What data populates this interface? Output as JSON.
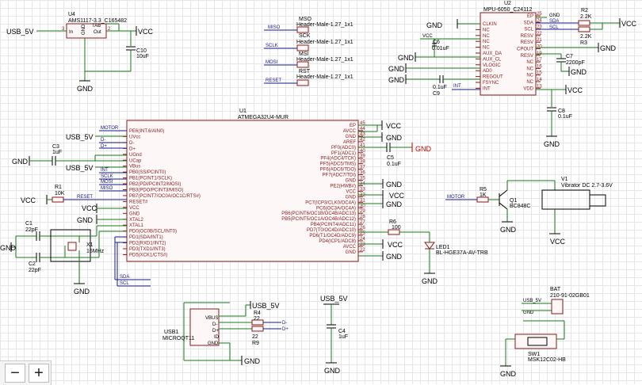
{
  "components": {
    "u4": {
      "ref": "U4",
      "part": "AMS1117-3.3_C165482",
      "pins": [
        "In",
        "GND",
        "Out",
        "TAB"
      ],
      "pin_numbers": [
        "3",
        "1",
        "2",
        "4"
      ]
    },
    "c10": {
      "ref": "C10",
      "value": "10uF"
    },
    "u2": {
      "ref": "U2",
      "part": "MPU-6050_C24112",
      "left_pins": [
        "CLKIN",
        "NC",
        "NC",
        "NC",
        "NC",
        "AUX_DA",
        "AUX_CL",
        "VLOGIC",
        "AD0",
        "REGOUT",
        "FSYNC",
        "INT"
      ],
      "right_pins": [
        "EP",
        "SDA",
        "SCL",
        "RESV",
        "RESV",
        "CPOUT",
        "RESV",
        "NC",
        "NC",
        "NC",
        "NC",
        "VDD"
      ],
      "right_numbers": [
        "25",
        "24",
        "23",
        "22",
        "21",
        "20",
        "19",
        "17",
        "16",
        "15",
        "14",
        "13"
      ]
    },
    "r2": {
      "ref": "R2",
      "value": "2.2K"
    },
    "r3": {
      "ref": "R3",
      "value": "2.2K"
    },
    "c6": {
      "ref": "C6",
      "value": "0.01uF"
    },
    "c7": {
      "ref": "C7",
      "value": "2200pF"
    },
    "c9": {
      "ref": "C9",
      "value": "0.1uF"
    },
    "c8": {
      "ref": "C8",
      "value": "0.1uF"
    },
    "headers": [
      {
        "net": "MISO",
        "ref": "MSO",
        "part": "Header-Male-1.27_1x1"
      },
      {
        "net": "SCLK",
        "ref": "SCK",
        "part": "Header-Male-1.27_1x1"
      },
      {
        "net": "MOSI",
        "ref": "MSI",
        "part": "Header-Male-1.27_1x1"
      },
      {
        "net": "RESET",
        "ref": "RST",
        "part": "Header-Male-1.27_1x1"
      }
    ],
    "u1": {
      "ref": "U1",
      "part": "ATMEGA32U4-MUR",
      "left_pins": [
        "PE6(INT.6/AIN0)",
        "UVcc",
        "D-",
        "D+",
        "UGnd",
        "UCap",
        "VBus",
        "PB0(SS/PCINT0)",
        "PB1(PCINT1/SCLK)",
        "PB2(PDI/PCINT2/MOSI)",
        "PB3(PDO/PCINT3/MISO)",
        "PB7(PCINT7/OC0A/OC1C/RTS#)",
        "RESET#",
        "VCC",
        "GND",
        "XTAL2",
        "XTAL1",
        "PD0(OC0B/SCL/INT0)",
        "PD1(SDA/INT1)",
        "PD2(RXD1/INT2)",
        "PD3(TXD1/INT3)",
        "PD5(XCK1/CTS#)"
      ],
      "right_pins": [
        "EP",
        "AVCC",
        "GND",
        "AREF",
        "PF0(ADC0)",
        "PF1(ADC1)",
        "PF4(ADC4/TCK)",
        "PF5(ADC5/TMS)",
        "PF6(ADC6/TDO)",
        "PF7(ADC7/TDI)",
        "GND",
        "PE2(HWB#)",
        "VCC",
        "GND",
        "PC7(ICP3/CLK0/OC4A)",
        "PC6(OC3A/OC4A)",
        "PB6(PCINT6/OC1B/OC4B/ADC13)",
        "PB5(PCINT5/OC1A/OC4B/ADC12)",
        "PB4(PCINT4/ADC11)",
        "PD7(T0/OC4D/ADC10)",
        "PD6(T1/OC4D/ADC9)",
        "PD4(ICP1/ADC8)",
        "AVCC",
        "GND"
      ],
      "right_numbers": [
        "45",
        "44",
        "43",
        "42",
        "41",
        "40",
        "39",
        "38",
        "37",
        "36",
        "35",
        "34",
        "33",
        "32",
        "31",
        "30",
        "29",
        "28",
        "27",
        "26",
        "25",
        "24",
        "23",
        "22"
      ]
    },
    "c3": {
      "ref": "C3",
      "value": "1uF"
    },
    "c5": {
      "ref": "C5",
      "value": "0.1uF"
    },
    "r1": {
      "ref": "R1",
      "value": "10K"
    },
    "c1": {
      "ref": "C1",
      "value": "22pF"
    },
    "c2": {
      "ref": "C2",
      "value": "22pF"
    },
    "x1": {
      "ref": "X1",
      "value": "16MHz"
    },
    "r5": {
      "ref": "R5",
      "value": "1K"
    },
    "q1": {
      "ref": "Q1",
      "value": "BC848C"
    },
    "v1": {
      "ref": "V1",
      "value": "Vibrator DC 2.7-3.6V"
    },
    "r6": {
      "ref": "R6",
      "value": "100"
    },
    "led1": {
      "ref": "LED1",
      "value": "BL-HGE37A-AV-TRB"
    },
    "usb1": {
      "ref": "USB1",
      "part": "MICROQT11",
      "pins": [
        "VBUS",
        "D-",
        "D+",
        "ID",
        "GND"
      ]
    },
    "r4": {
      "ref": "R4",
      "value": "22"
    },
    "r9": {
      "ref": "R9",
      "value": "22"
    },
    "c4": {
      "ref": "C4",
      "value": "1uF"
    },
    "bat": {
      "ref": "BAT",
      "part": "210-91-02GB01"
    },
    "sw1": {
      "ref": "SW1",
      "part": "MSK12C02-HB"
    }
  },
  "nets": {
    "usb5v": "USB_5V",
    "vcc": "VCC",
    "gnd": "GND",
    "reset": "RESET",
    "miso": "MISO",
    "sclk": "SCLK",
    "mosi": "MOSI",
    "motor": "MOTOR",
    "int": "INT",
    "sda": "SDA",
    "scl": "SCL",
    "dminus": "D-",
    "dplus": "D+"
  },
  "colors": {
    "wire": "#1a7a1a",
    "net_label": "#1a1a8a",
    "component": "#8b1a1a",
    "flag_red": "#cc0000",
    "grid": "#e6e6e6"
  },
  "ui": {
    "zoom_out_icon": "minus-icon",
    "zoom_in_icon": "plus-icon",
    "zoom_out_label": "−",
    "zoom_in_label": "+"
  }
}
